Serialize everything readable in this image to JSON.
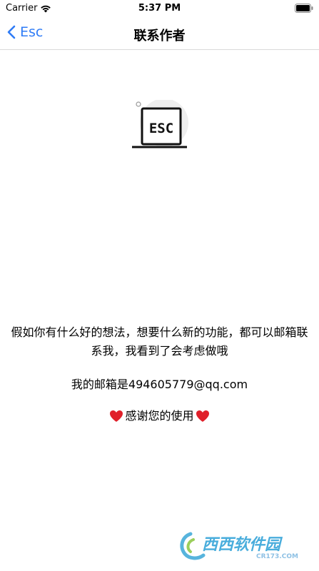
{
  "status_bar": {
    "carrier": "Carrier",
    "time": "5:37 PM"
  },
  "nav": {
    "back_label": "Esc",
    "title": "联系作者"
  },
  "logo": {
    "text": "ESC"
  },
  "content": {
    "intro": "假如你有什么好的想法，想要什么新的功能，都可以邮箱联系我，我看到了会考虑做哦",
    "email_line": "我的邮箱是494605779@qq.com",
    "thanks": "感谢您的使用"
  },
  "watermark": {
    "text": "西西软件园",
    "url": "CR173.COM"
  },
  "colors": {
    "accent": "#2f7cf6",
    "heart": "#e0202a",
    "divider": "#d9d9d9"
  }
}
